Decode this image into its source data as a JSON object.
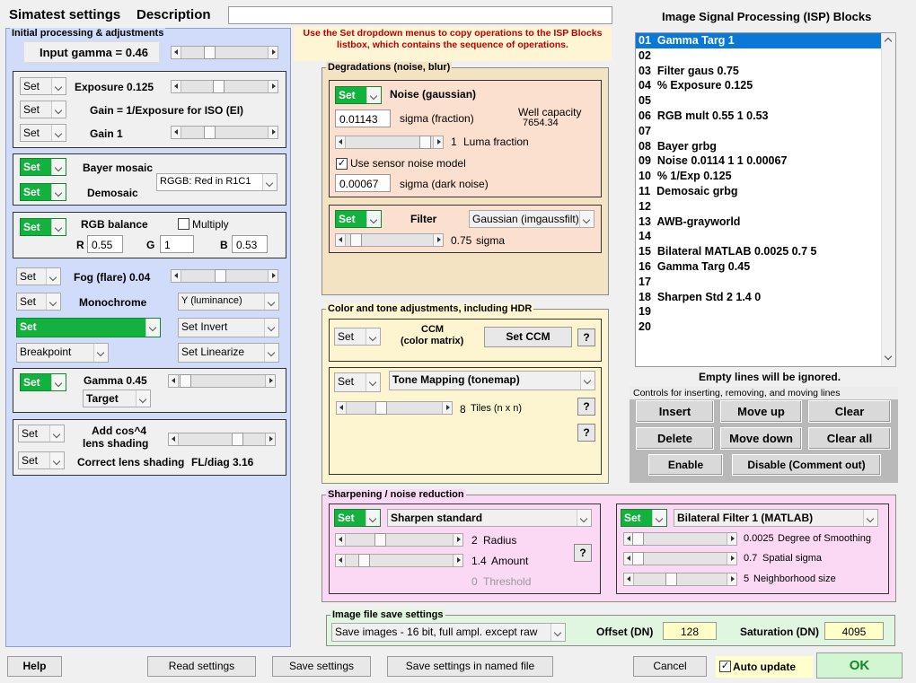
{
  "header": {
    "title": "Simatest settings",
    "desc_label": "Description",
    "desc_value": "",
    "instructions": "Use the Set dropdown menus to copy operations to the ISP Blocks listbox, which contains the sequence of operations.",
    "isp_title": "Image Signal Processing (ISP) Blocks"
  },
  "initial": {
    "title": "Initial processing & adjustments",
    "input_gamma": "Input gamma = 0.46",
    "exposure": {
      "set": "Set",
      "label": "Exposure  0.125",
      "gain_set": "Set",
      "gain_text": "Gain = 1/Exposure for ISO (EI)",
      "gain2_set": "Set",
      "gain2_label": "Gain  1"
    },
    "bayer": {
      "set": "Set",
      "label": "Bayer mosaic",
      "dem_set": "Set",
      "dem_label": "Demosaic",
      "pattern": "RGGB: Red in R1C1"
    },
    "rgb": {
      "set": "Set",
      "label": "RGB balance",
      "multiply": "Multiply",
      "r_label": "R",
      "r": "0.55",
      "g_label": "G",
      "g": "1",
      "b_label": "B",
      "b": "0.53"
    },
    "fog": {
      "set": "Set",
      "label": "Fog (flare)  0.04"
    },
    "mono": {
      "set": "Set",
      "label": "Monochrome",
      "option": "Y (luminance)"
    },
    "invert": {
      "set": "Set",
      "option": "Set Invert"
    },
    "linearize": {
      "set": "Breakpoint",
      "option": "Set Linearize"
    },
    "gamma": {
      "set": "Set",
      "label": "Gamma  0.45",
      "target": "Target"
    },
    "cos4": {
      "set": "Set",
      "label1": "Add cos^4",
      "label2": "lens shading",
      "set2": "Set",
      "correct": "Correct lens shading",
      "fl": "FL/diag 3.16"
    }
  },
  "degradations": {
    "title": "Degradations (noise, blur)",
    "noise": {
      "set": "Set",
      "label": "Noise (gaussian)",
      "sigma_value": "0.01143",
      "sigma_label": "sigma (fraction)",
      "well_label": "Well capacity",
      "well_value": "7654.34",
      "luma_value": "1",
      "luma_label": "Luma fraction",
      "sensor_check": "✓",
      "sensor_label": "Use sensor noise model",
      "dark_value": "0.00067",
      "dark_label": "sigma (dark noise)"
    },
    "filter": {
      "set": "Set",
      "label": "Filter",
      "option": "Gaussian (imgaussfilt)",
      "sigma_value": "0.75",
      "sigma_label": "sigma"
    }
  },
  "color": {
    "title": "Color and tone adjustments, including HDR",
    "ccm": {
      "set": "Set",
      "label1": "CCM",
      "label2": "(color matrix)",
      "button": "Set CCM",
      "help": "?"
    },
    "tone": {
      "set": "Set",
      "option": "Tone Mapping (tonemap)",
      "tiles_value": "8",
      "tiles_label": "Tiles (n x n)",
      "help1": "?",
      "help2": "?"
    }
  },
  "sharpen": {
    "title": "Sharpening / noise reduction",
    "left": {
      "set": "Set",
      "option": "Sharpen standard",
      "radius_value": "2",
      "radius_label": "Radius",
      "amount_value": "1.4",
      "amount_label": "Amount",
      "threshold_value": "0",
      "threshold_label": "Threshold",
      "help": "?"
    },
    "right": {
      "set": "Set",
      "option": "Bilateral Filter 1 (MATLAB)",
      "smooth_value": "0.0025",
      "smooth_label": "Degree of Smoothing",
      "spatial_value": "0.7",
      "spatial_label": "Spatial sigma",
      "nbhd_value": "5",
      "nbhd_label": "Neighborhood size"
    }
  },
  "save": {
    "title": "Image file save settings",
    "option": "Save images - 16 bit, full ampl. except raw",
    "offset_label": "Offset (DN)",
    "offset": "128",
    "saturation_label": "Saturation (DN)",
    "saturation": "4095"
  },
  "isp": {
    "items": [
      "01  Gamma Targ 1",
      "02",
      "03  Filter gaus 0.75",
      "04  % Exposure 0.125",
      "05",
      "06  RGB mult 0.55 1 0.53",
      "07",
      "08  Bayer grbg",
      "09  Noise 0.0114 1 1 0.00067",
      "10  % 1/Exp 0.125",
      "11  Demosaic grbg",
      "12",
      "13  AWB-grayworld",
      "14",
      "15  Bilateral MATLAB 0.0025 0.7 5",
      "16  Gamma Targ 0.45",
      "17",
      "18  Sharpen Std 2 1.4 0",
      "19",
      "20"
    ],
    "empty_note": "Empty lines will be ignored.",
    "controls_title": "Controls for inserting, removing, and moving lines",
    "insert": "Insert",
    "move_up": "Move up",
    "clear": "Clear",
    "delete": "Delete",
    "move_down": "Move down",
    "clear_all": "Clear all",
    "enable": "Enable",
    "disable": "Disable (Comment out)"
  },
  "footer": {
    "help": "Help",
    "read": "Read settings",
    "save": "Save settings",
    "save_named": "Save settings in named file",
    "cancel": "Cancel",
    "auto_check": "✓",
    "auto": "Auto update",
    "ok": "OK"
  }
}
